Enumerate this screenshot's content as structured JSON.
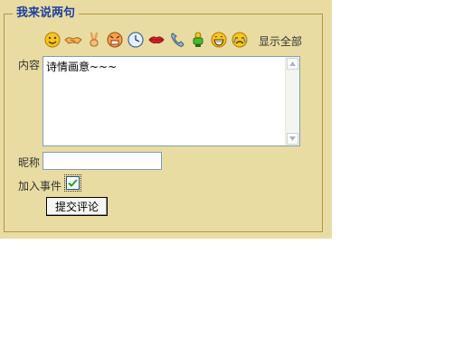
{
  "legend": "我来说两句",
  "emoticons": [
    {
      "icon": "smile-icon"
    },
    {
      "icon": "handshake-icon"
    },
    {
      "icon": "victory-hand-icon"
    },
    {
      "icon": "angry-face-icon"
    },
    {
      "icon": "clock-icon"
    },
    {
      "icon": "lips-icon"
    },
    {
      "icon": "phone-icon"
    },
    {
      "icon": "green-figure-icon"
    },
    {
      "icon": "grin-icon"
    },
    {
      "icon": "crying-face-icon"
    }
  ],
  "show_all": "显示全部",
  "content": {
    "label": "内容",
    "value": "诗情画意~~~"
  },
  "nickname": {
    "label": "昵称",
    "value": ""
  },
  "join_event": {
    "label": "加入事件",
    "checked": true
  },
  "submit_label": "提交评论",
  "colors": {
    "panel_bg": "#e9dca2",
    "border": "#b49440",
    "legend_text": "#1e3fa0"
  }
}
